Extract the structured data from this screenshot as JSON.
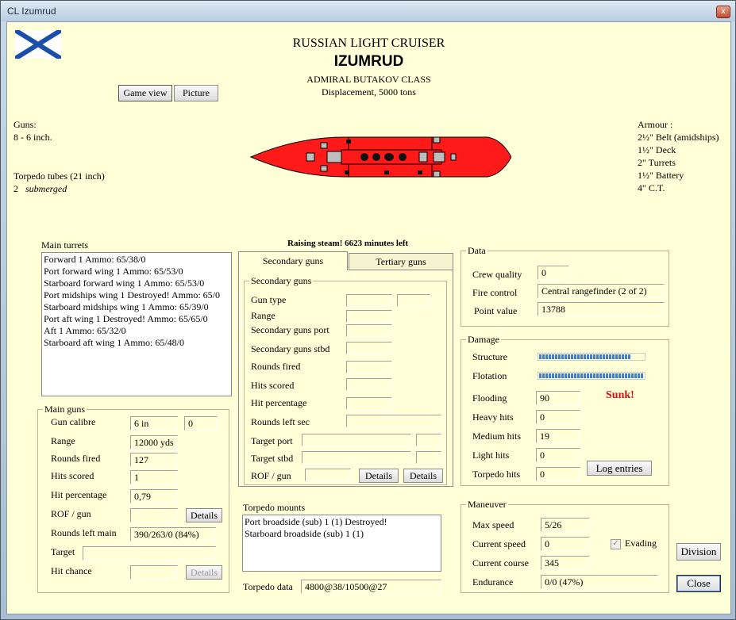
{
  "window": {
    "title": "CL Izumrud",
    "close_glyph": "x"
  },
  "header": {
    "line1": "RUSSIAN LIGHT CRUISER",
    "name": "IZUMRUD",
    "class": "ADMIRAL BUTAKOV CLASS",
    "displacement": "Displacement, 5000 tons"
  },
  "view_buttons": {
    "game_view": "Game view",
    "picture": "Picture"
  },
  "guns": {
    "label": "Guns:",
    "value": "8 - 6 inch."
  },
  "torpedo_tubes": {
    "label": "Torpedo tubes (21 inch)",
    "count": "2",
    "type": "submerged"
  },
  "armour": {
    "label": "Armour :",
    "items": [
      "2½\" Belt (amidships)",
      "1½\" Deck",
      "2\" Turrets",
      "1½\" Battery",
      "4\" C.T."
    ]
  },
  "status_message": "Raising steam! 6623 minutes left",
  "main_turrets": {
    "label": "Main turrets",
    "items": [
      "Forward 1 Ammo: 65/38/0",
      "Port forward wing 1 Ammo: 65/53/0",
      "Starboard forward wing 1 Ammo: 65/53/0",
      "Port midships wing 1 Destroyed! Ammo: 65/0",
      "Starboard midships wing 1 Ammo: 65/39/0",
      "Port aft wing 1 Destroyed! Ammo: 65/65/0",
      "Aft 1 Ammo: 65/32/0",
      "Starboard aft wing 1 Ammo: 65/48/0"
    ]
  },
  "main_guns": {
    "label": "Main guns",
    "gun_calibre_label": "Gun calibre",
    "gun_calibre": "6 in",
    "gun_calibre_extra": "0",
    "range_label": "Range",
    "range": "12000 yds",
    "rounds_fired_label": "Rounds fired",
    "rounds_fired": "127",
    "hits_scored_label": "Hits scored",
    "hits_scored": "1",
    "hit_percentage_label": "Hit percentage",
    "hit_percentage": "0,79",
    "rof_label": "ROF / gun",
    "rof": "",
    "details_label": "Details",
    "rounds_left_label": "Rounds left main",
    "rounds_left": "390/263/0 (84%)",
    "target_label": "Target",
    "target": "",
    "hit_chance_label": "Hit chance",
    "hit_chance": "",
    "details2_label": "Details"
  },
  "tabs": {
    "secondary": "Secondary guns",
    "tertiary": "Tertiary guns"
  },
  "secondary_guns": {
    "label": "Secondary guns",
    "gun_type_label": "Gun type",
    "range_label": "Range",
    "port_label": "Secondary guns port",
    "stbd_label": "Secondary guns stbd",
    "rounds_fired_label": "Rounds fired",
    "hits_scored_label": "Hits scored",
    "hit_percentage_label": "Hit percentage",
    "rounds_left_label": "Rounds left sec",
    "target_port_label": "Target port",
    "target_stbd_label": "Target stbd",
    "rof_label": "ROF / gun",
    "details_label": "Details",
    "details2_label": "Details"
  },
  "torpedo_mounts": {
    "label": "Torpedo mounts",
    "items": [
      "Port broadside (sub) 1 (1) Destroyed!",
      "Starboard broadside (sub) 1 (1)"
    ],
    "data_label": "Torpedo data",
    "data": "4800@38/10500@27"
  },
  "data_group": {
    "label": "Data",
    "crew_quality_label": "Crew quality",
    "crew_quality": "0",
    "fire_control_label": "Fire control",
    "fire_control": "Central rangefinder (2 of 2)",
    "point_value_label": "Point value",
    "point_value": "13788"
  },
  "damage": {
    "label": "Damage",
    "structure_label": "Structure",
    "flotation_label": "Flotation",
    "flooding_label": "Flooding",
    "flooding": "90",
    "sunk_label": "Sunk!",
    "heavy_hits_label": "Heavy hits",
    "heavy_hits": "0",
    "medium_hits_label": "Medium hits",
    "medium_hits": "19",
    "light_hits_label": "Light hits",
    "light_hits": "0",
    "torpedo_hits_label": "Torpedo hits",
    "torpedo_hits": "0",
    "log_entries_label": "Log entries"
  },
  "maneuver": {
    "label": "Maneuver",
    "max_speed_label": "Max speed",
    "max_speed": "5/26",
    "current_speed_label": "Current speed",
    "current_speed": "0",
    "evading_label": "Evading",
    "evading_checked": true,
    "check_glyph": "✓",
    "current_course_label": "Current course",
    "current_course": "345",
    "endurance_label": "Endurance",
    "endurance": "0/0 (47%)"
  },
  "buttons": {
    "division": "Division",
    "close": "Close"
  },
  "colors": {
    "background": "#ffffd8",
    "sunk": "#cc1111",
    "ship": "#ff1a1a",
    "bar": "#3f7fcf"
  }
}
